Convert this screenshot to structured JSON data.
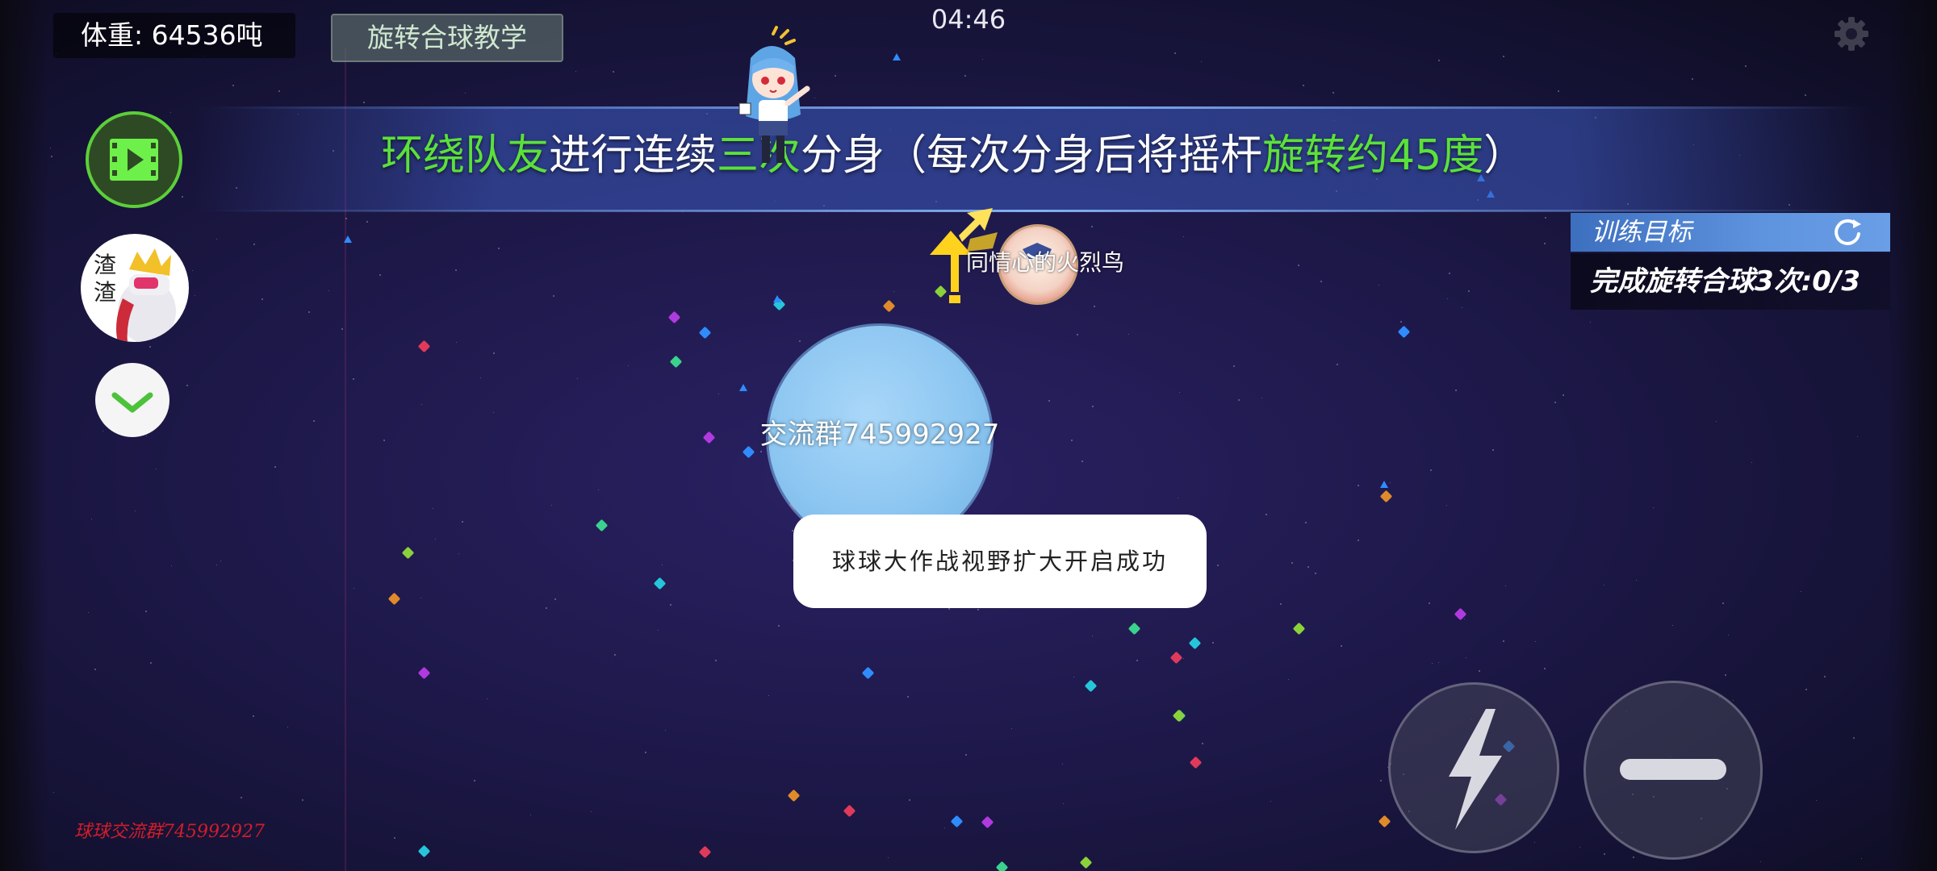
{
  "hud": {
    "weight": "体重: 64536吨",
    "tutorial_button": "旋转合球教学",
    "clock": "04:46",
    "settings_icon": "gear-icon"
  },
  "banner": {
    "parts": [
      {
        "text": "环绕队友",
        "color": "green"
      },
      {
        "text": "进行连续",
        "color": "white"
      },
      {
        "text": "三次",
        "color": "green"
      },
      {
        "text": "分身（每次分身后将摇杆",
        "color": "white"
      },
      {
        "text": "旋转约45度",
        "color": "green"
      },
      {
        "text": "）",
        "color": "white"
      }
    ],
    "colors": {
      "green": "#5be13a",
      "white": "#ffffff"
    }
  },
  "left_controls": {
    "video_icon": "film-icon",
    "avatar_label": "渣渣",
    "expand_icon": "chevron-down-icon"
  },
  "training": {
    "title": "训练目标",
    "refresh_icon": "refresh-icon",
    "objective": "完成旋转合球3次:0/3"
  },
  "cells": {
    "player_name": "交流群745992927",
    "teammate_name": "同情心的火烈鸟",
    "player_color": "#8cc6f1"
  },
  "toast": "球球大作战视野扩大开启成功",
  "actions": {
    "boost_icon": "lightning-icon",
    "split_icon": "split-bar-icon"
  },
  "watermark": "球球交流群745992927"
}
